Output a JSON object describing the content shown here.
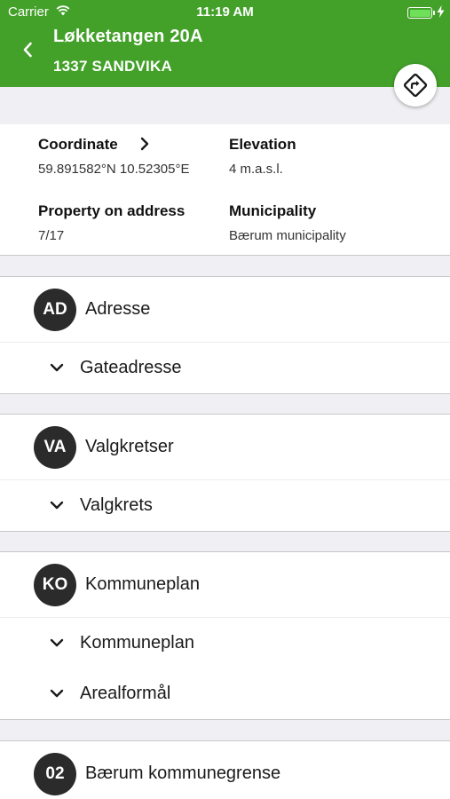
{
  "status_bar": {
    "carrier": "Carrier",
    "time": "11:19 AM",
    "battery_level": 1.0
  },
  "nav": {
    "title": "Løkketangen 20A",
    "subtitle": "1337 SANDVIKA",
    "back_icon": "chevron-left-icon",
    "directions_icon": "directions-icon",
    "brand_color": "#43a12a"
  },
  "info": {
    "coordinate_label": "Coordinate",
    "coordinate_value": "59.891582°N  10.52305°E",
    "elevation_label": "Elevation",
    "elevation_value": "4 m.a.s.l.",
    "property_label": "Property on address",
    "property_value": "7/17",
    "municipality_label": "Municipality",
    "municipality_value": "Bærum municipality"
  },
  "sections": [
    {
      "badge": "AD",
      "title": "Adresse",
      "items": [
        "Gateadresse"
      ]
    },
    {
      "badge": "VA",
      "title": "Valgkretser",
      "items": [
        "Valgkrets"
      ]
    },
    {
      "badge": "KO",
      "title": "Kommuneplan",
      "items": [
        "Kommuneplan",
        "Arealformål"
      ]
    },
    {
      "badge": "02",
      "title": "Bærum kommunegrense",
      "items": []
    }
  ]
}
